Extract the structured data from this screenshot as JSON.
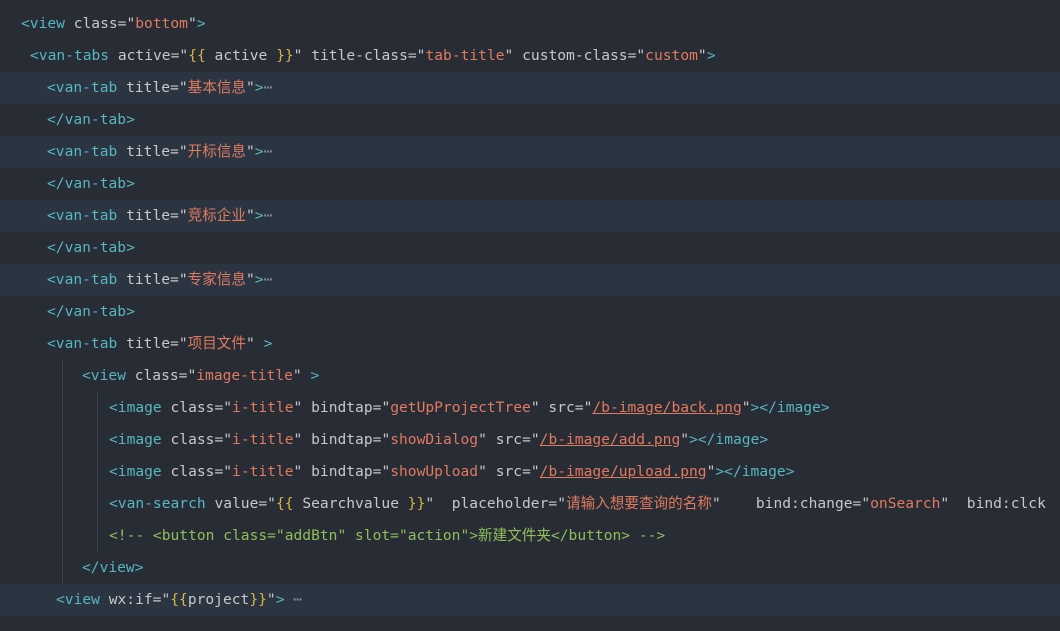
{
  "editor": {
    "lines": [
      {
        "folded": false,
        "guides": [],
        "tokens": [
          {
            "t": "<view",
            "c": "tag"
          },
          {
            "t": " class",
            "c": "attr"
          },
          {
            "t": "=",
            "c": "eq"
          },
          {
            "t": "\"",
            "c": "q"
          },
          {
            "t": "bottom",
            "c": "str"
          },
          {
            "t": "\"",
            "c": "q"
          },
          {
            "t": ">",
            "c": "tag"
          }
        ]
      },
      {
        "folded": false,
        "guides": [],
        "tokens": [
          {
            "t": "<van-tabs",
            "c": "tag"
          },
          {
            "t": " active",
            "c": "attr"
          },
          {
            "t": "=",
            "c": "eq"
          },
          {
            "t": "\"",
            "c": "q"
          },
          {
            "t": "{{",
            "c": "brace"
          },
          {
            "t": " active ",
            "c": "varname"
          },
          {
            "t": "}}",
            "c": "brace"
          },
          {
            "t": "\"",
            "c": "q"
          },
          {
            "t": " title-class",
            "c": "attr"
          },
          {
            "t": "=",
            "c": "eq"
          },
          {
            "t": "\"",
            "c": "q"
          },
          {
            "t": "tab-title",
            "c": "str"
          },
          {
            "t": "\"",
            "c": "q"
          },
          {
            "t": " custom-class",
            "c": "attr"
          },
          {
            "t": "=",
            "c": "eq"
          },
          {
            "t": "\"",
            "c": "q"
          },
          {
            "t": "custom",
            "c": "str"
          },
          {
            "t": "\"",
            "c": "q"
          },
          {
            "t": ">",
            "c": "tag"
          }
        ]
      },
      {
        "folded": true,
        "guides": [],
        "tokens": [
          {
            "t": "<van-tab",
            "c": "tag"
          },
          {
            "t": " title",
            "c": "attr"
          },
          {
            "t": "=",
            "c": "eq"
          },
          {
            "t": "\"",
            "c": "q"
          },
          {
            "t": "基本信息",
            "c": "str"
          },
          {
            "t": "\"",
            "c": "q"
          },
          {
            "t": ">",
            "c": "tag"
          },
          {
            "t": "⋯",
            "c": "fold"
          }
        ]
      },
      {
        "folded": false,
        "guides": [],
        "tokens": [
          {
            "t": "</van-tab>",
            "c": "tag"
          }
        ]
      },
      {
        "folded": true,
        "guides": [],
        "tokens": [
          {
            "t": "<van-tab",
            "c": "tag"
          },
          {
            "t": " title",
            "c": "attr"
          },
          {
            "t": "=",
            "c": "eq"
          },
          {
            "t": "\"",
            "c": "q"
          },
          {
            "t": "开标信息",
            "c": "str"
          },
          {
            "t": "\"",
            "c": "q"
          },
          {
            "t": ">",
            "c": "tag"
          },
          {
            "t": "⋯",
            "c": "fold"
          }
        ]
      },
      {
        "folded": false,
        "guides": [],
        "tokens": [
          {
            "t": "</van-tab>",
            "c": "tag"
          }
        ]
      },
      {
        "folded": true,
        "guides": [],
        "tokens": [
          {
            "t": "<van-tab",
            "c": "tag"
          },
          {
            "t": " title",
            "c": "attr"
          },
          {
            "t": "=",
            "c": "eq"
          },
          {
            "t": "\"",
            "c": "q"
          },
          {
            "t": "竞标企业",
            "c": "str"
          },
          {
            "t": "\"",
            "c": "q"
          },
          {
            "t": ">",
            "c": "tag"
          },
          {
            "t": "⋯",
            "c": "fold"
          }
        ]
      },
      {
        "folded": false,
        "guides": [],
        "tokens": [
          {
            "t": "</van-tab>",
            "c": "tag"
          }
        ]
      },
      {
        "folded": true,
        "guides": [],
        "tokens": [
          {
            "t": "<van-tab",
            "c": "tag"
          },
          {
            "t": " title",
            "c": "attr"
          },
          {
            "t": "=",
            "c": "eq"
          },
          {
            "t": "\"",
            "c": "q"
          },
          {
            "t": "专家信息",
            "c": "str"
          },
          {
            "t": "\"",
            "c": "q"
          },
          {
            "t": ">",
            "c": "tag"
          },
          {
            "t": "⋯",
            "c": "fold"
          }
        ]
      },
      {
        "folded": false,
        "guides": [],
        "tokens": [
          {
            "t": "</van-tab>",
            "c": "tag"
          }
        ]
      },
      {
        "folded": false,
        "guides": [],
        "tokens": [
          {
            "t": "<van-tab",
            "c": "tag"
          },
          {
            "t": " title",
            "c": "attr"
          },
          {
            "t": "=",
            "c": "eq"
          },
          {
            "t": "\"",
            "c": "q"
          },
          {
            "t": "项目文件",
            "c": "str"
          },
          {
            "t": "\"",
            "c": "q"
          },
          {
            "t": " >",
            "c": "tag"
          }
        ]
      },
      {
        "folded": false,
        "guides": [
          1
        ],
        "tokens": [
          {
            "t": "<view",
            "c": "tag"
          },
          {
            "t": " class",
            "c": "attr"
          },
          {
            "t": "=",
            "c": "eq"
          },
          {
            "t": "\"",
            "c": "q"
          },
          {
            "t": "image-title",
            "c": "str"
          },
          {
            "t": "\"",
            "c": "q"
          },
          {
            "t": " >",
            "c": "tag"
          }
        ]
      },
      {
        "folded": false,
        "guides": [
          1,
          2
        ],
        "tokens": [
          {
            "t": "<image",
            "c": "tag"
          },
          {
            "t": " class",
            "c": "attr"
          },
          {
            "t": "=",
            "c": "eq"
          },
          {
            "t": "\"",
            "c": "q"
          },
          {
            "t": "i-title",
            "c": "str"
          },
          {
            "t": "\"",
            "c": "q"
          },
          {
            "t": " bindtap",
            "c": "attr"
          },
          {
            "t": "=",
            "c": "eq"
          },
          {
            "t": "\"",
            "c": "q"
          },
          {
            "t": "getUpProjectTree",
            "c": "str"
          },
          {
            "t": "\"",
            "c": "q"
          },
          {
            "t": " src",
            "c": "attr"
          },
          {
            "t": "=",
            "c": "eq"
          },
          {
            "t": "\"",
            "c": "q"
          },
          {
            "t": "/b-image/back.png",
            "c": "link"
          },
          {
            "t": "\"",
            "c": "q"
          },
          {
            "t": "></image>",
            "c": "tag"
          }
        ]
      },
      {
        "folded": false,
        "guides": [
          1,
          2
        ],
        "tokens": [
          {
            "t": "<image",
            "c": "tag"
          },
          {
            "t": " class",
            "c": "attr"
          },
          {
            "t": "=",
            "c": "eq"
          },
          {
            "t": "\"",
            "c": "q"
          },
          {
            "t": "i-title",
            "c": "str"
          },
          {
            "t": "\"",
            "c": "q"
          },
          {
            "t": " bindtap",
            "c": "attr"
          },
          {
            "t": "=",
            "c": "eq"
          },
          {
            "t": "\"",
            "c": "q"
          },
          {
            "t": "showDialog",
            "c": "str"
          },
          {
            "t": "\"",
            "c": "q"
          },
          {
            "t": " src",
            "c": "attr"
          },
          {
            "t": "=",
            "c": "eq"
          },
          {
            "t": "\"",
            "c": "q"
          },
          {
            "t": "/b-image/add.png",
            "c": "link"
          },
          {
            "t": "\"",
            "c": "q"
          },
          {
            "t": "></image>",
            "c": "tag"
          }
        ]
      },
      {
        "folded": false,
        "guides": [
          1,
          2
        ],
        "tokens": [
          {
            "t": "<image",
            "c": "tag"
          },
          {
            "t": " class",
            "c": "attr"
          },
          {
            "t": "=",
            "c": "eq"
          },
          {
            "t": "\"",
            "c": "q"
          },
          {
            "t": "i-title",
            "c": "str"
          },
          {
            "t": "\"",
            "c": "q"
          },
          {
            "t": " bindtap",
            "c": "attr"
          },
          {
            "t": "=",
            "c": "eq"
          },
          {
            "t": "\"",
            "c": "q"
          },
          {
            "t": "showUpload",
            "c": "str"
          },
          {
            "t": "\"",
            "c": "q"
          },
          {
            "t": " src",
            "c": "attr"
          },
          {
            "t": "=",
            "c": "eq"
          },
          {
            "t": "\"",
            "c": "q"
          },
          {
            "t": "/b-image/upload.png",
            "c": "link"
          },
          {
            "t": "\"",
            "c": "q"
          },
          {
            "t": "></image>",
            "c": "tag"
          }
        ]
      },
      {
        "folded": false,
        "guides": [
          1,
          2
        ],
        "tokens": [
          {
            "t": "<van-search",
            "c": "tag"
          },
          {
            "t": " value",
            "c": "attr"
          },
          {
            "t": "=",
            "c": "eq"
          },
          {
            "t": "\"",
            "c": "q"
          },
          {
            "t": "{{",
            "c": "brace"
          },
          {
            "t": " Searchvalue ",
            "c": "varname"
          },
          {
            "t": "}}",
            "c": "brace"
          },
          {
            "t": "\"",
            "c": "q"
          },
          {
            "t": "  placeholder",
            "c": "attr"
          },
          {
            "t": "=",
            "c": "eq"
          },
          {
            "t": "\"",
            "c": "q"
          },
          {
            "t": "请输入想要查询的名称",
            "c": "str"
          },
          {
            "t": "\"",
            "c": "q"
          },
          {
            "t": "    bind:change",
            "c": "attr"
          },
          {
            "t": "=",
            "c": "eq"
          },
          {
            "t": "\"",
            "c": "q"
          },
          {
            "t": "onSearch",
            "c": "str"
          },
          {
            "t": "\"",
            "c": "q"
          },
          {
            "t": "  bind:clck",
            "c": "attr"
          }
        ]
      },
      {
        "folded": false,
        "guides": [
          1,
          2
        ],
        "tokens": [
          {
            "t": "<!-- <button class=\"addBtn\" slot=\"action\">新建文件夹</button> -->",
            "c": "comment"
          }
        ]
      },
      {
        "folded": false,
        "guides": [
          1
        ],
        "tokens": [
          {
            "t": "</view>",
            "c": "tag"
          }
        ]
      },
      {
        "folded": true,
        "guides": [],
        "tokens": [
          {
            "t": "<view",
            "c": "tag"
          },
          {
            "t": " wx:if",
            "c": "attr"
          },
          {
            "t": "=",
            "c": "eq"
          },
          {
            "t": "\"",
            "c": "q"
          },
          {
            "t": "{{",
            "c": "brace"
          },
          {
            "t": "project",
            "c": "varname"
          },
          {
            "t": "}}",
            "c": "brace"
          },
          {
            "t": "\"",
            "c": "q"
          },
          {
            "t": ">",
            "c": "tag"
          },
          {
            "t": " ⋯",
            "c": "fold"
          }
        ]
      }
    ]
  }
}
